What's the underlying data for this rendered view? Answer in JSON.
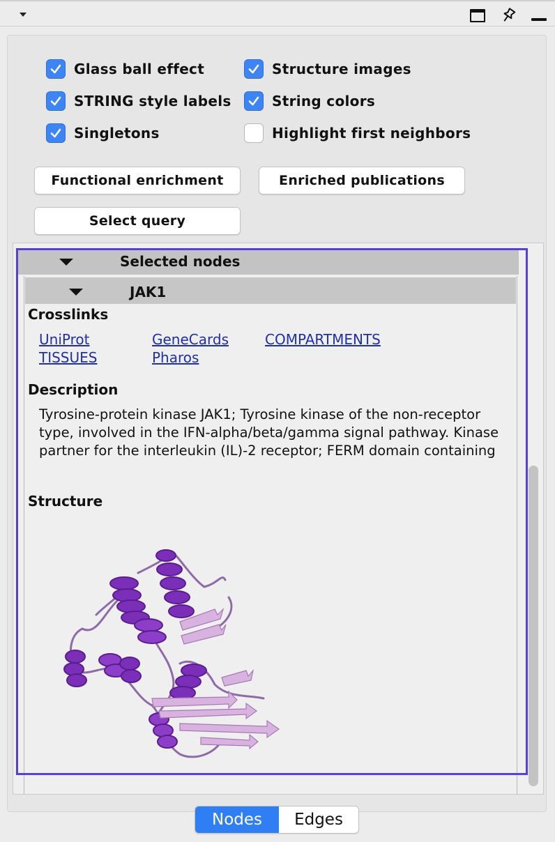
{
  "options": {
    "glass_ball": {
      "label": "Glass ball effect",
      "checked": true
    },
    "string_labels": {
      "label": "STRING style labels",
      "checked": true
    },
    "singletons": {
      "label": "Singletons",
      "checked": true
    },
    "structure_images": {
      "label": "Structure images",
      "checked": true
    },
    "string_colors": {
      "label": "String colors",
      "checked": true
    },
    "highlight_neighbors": {
      "label": "Highlight first neighbors",
      "checked": false
    }
  },
  "buttons": {
    "functional_enrichment": "Functional enrichment",
    "enriched_publications": "Enriched publications",
    "select_query": "Select query"
  },
  "selected_nodes": {
    "title": "Selected nodes",
    "node": {
      "name": "JAK1",
      "crosslinks_heading": "Crosslinks",
      "crosslinks": [
        "UniProt",
        "GeneCards",
        "COMPARTMENTS",
        "TISSUES",
        "Pharos"
      ],
      "description_heading": "Description",
      "description": "Tyrosine-protein kinase JAK1; Tyrosine kinase of the non-receptor type, involved in the IFN-alpha/beta/gamma signal pathway. Kinase partner for the interleukin (IL)-2 receptor; FERM domain containing",
      "structure_heading": "Structure"
    }
  },
  "tabs": {
    "nodes": "Nodes",
    "edges": "Edges",
    "active": "nodes"
  },
  "colors": {
    "accent": "#3d84f5",
    "link": "#1f2fb0",
    "highlight_border": "#5a3fd6",
    "helix": "#7b2fb8",
    "sheet": "#d9b3e0"
  },
  "icons": [
    "menu-arrow-icon",
    "window-icon",
    "pin-icon",
    "minimize-icon",
    "checkmark-icon",
    "triangle-down-icon"
  ]
}
